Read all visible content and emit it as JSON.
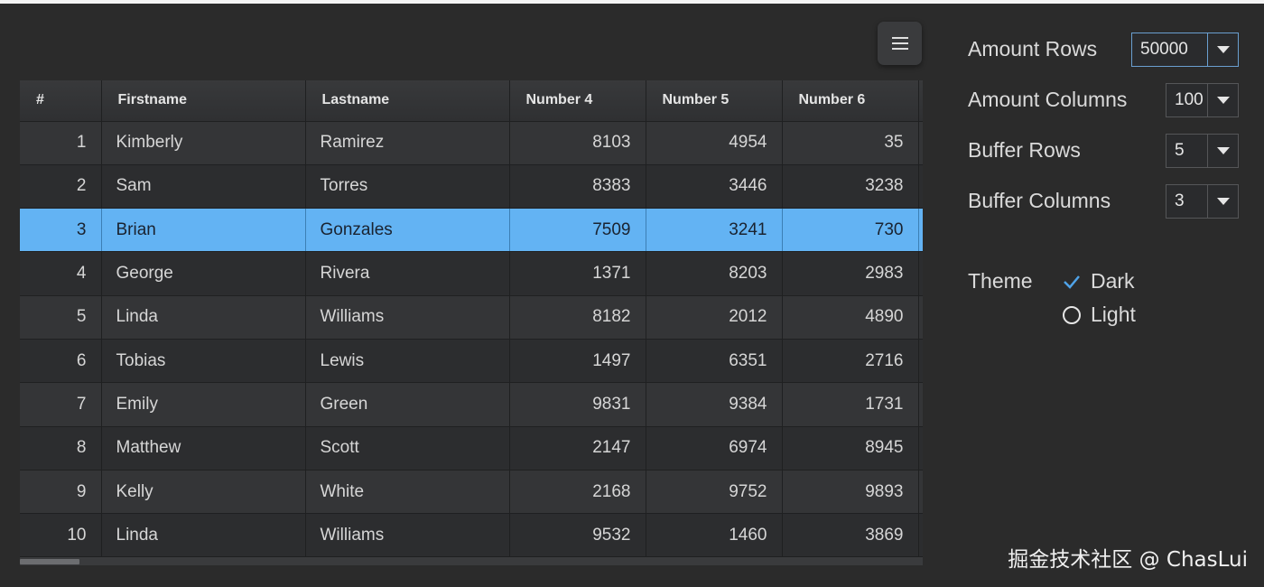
{
  "grid": {
    "columns": [
      "#",
      "Firstname",
      "Lastname",
      "Number 4",
      "Number 5",
      "Number 6"
    ],
    "rows": [
      {
        "idx": "1",
        "first": "Kimberly",
        "last": "Ramirez",
        "n4": "8103",
        "n5": "4954",
        "n6": "35"
      },
      {
        "idx": "2",
        "first": "Sam",
        "last": "Torres",
        "n4": "8383",
        "n5": "3446",
        "n6": "3238"
      },
      {
        "idx": "3",
        "first": "Brian",
        "last": "Gonzales",
        "n4": "7509",
        "n5": "3241",
        "n6": "730"
      },
      {
        "idx": "4",
        "first": "George",
        "last": "Rivera",
        "n4": "1371",
        "n5": "8203",
        "n6": "2983"
      },
      {
        "idx": "5",
        "first": "Linda",
        "last": "Williams",
        "n4": "8182",
        "n5": "2012",
        "n6": "4890"
      },
      {
        "idx": "6",
        "first": "Tobias",
        "last": "Lewis",
        "n4": "1497",
        "n5": "6351",
        "n6": "2716"
      },
      {
        "idx": "7",
        "first": "Emily",
        "last": "Green",
        "n4": "9831",
        "n5": "9384",
        "n6": "1731"
      },
      {
        "idx": "8",
        "first": "Matthew",
        "last": "Scott",
        "n4": "2147",
        "n5": "6974",
        "n6": "8945"
      },
      {
        "idx": "9",
        "first": "Kelly",
        "last": "White",
        "n4": "2168",
        "n5": "9752",
        "n6": "9893"
      },
      {
        "idx": "10",
        "first": "Linda",
        "last": "Williams",
        "n4": "9532",
        "n5": "1460",
        "n6": "3869"
      }
    ],
    "selected_row": 2,
    "selection_color": "#63b3f3"
  },
  "menu_button": {
    "icon": "hamburger-menu-icon"
  },
  "settings": {
    "amount_rows": {
      "label": "Amount Rows",
      "value": "50000"
    },
    "amount_columns": {
      "label": "Amount Columns",
      "value": "100"
    },
    "buffer_rows": {
      "label": "Buffer Rows",
      "value": "5"
    },
    "buffer_columns": {
      "label": "Buffer Columns",
      "value": "3"
    },
    "theme": {
      "label": "Theme",
      "options": [
        {
          "label": "Dark",
          "selected": true
        },
        {
          "label": "Light",
          "selected": false
        }
      ]
    }
  },
  "watermark": "掘金技术社区 @ ChasLui"
}
